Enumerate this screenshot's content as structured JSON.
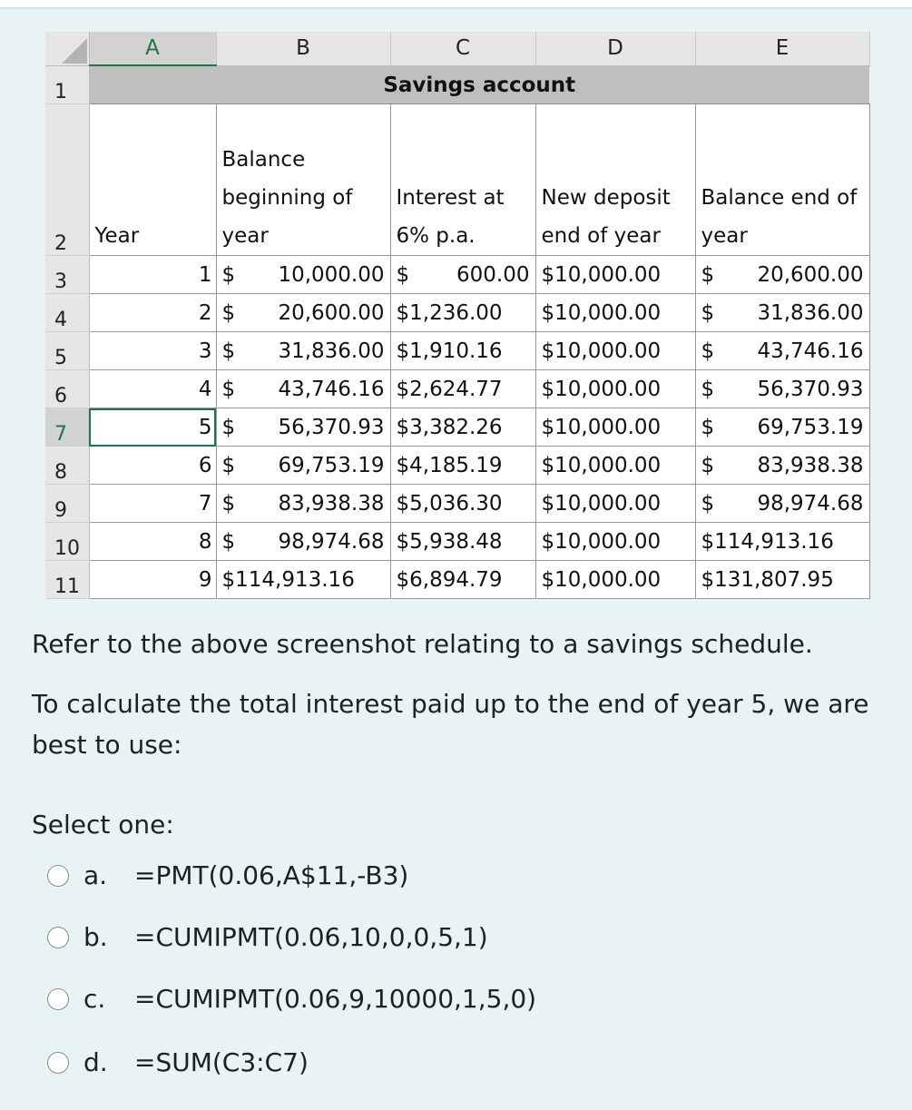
{
  "spreadsheet": {
    "columns": [
      "A",
      "B",
      "C",
      "D",
      "E"
    ],
    "selected_column": "A",
    "selected_row": "7",
    "title_row": {
      "row": "1",
      "title": "Savings account"
    },
    "header_row": {
      "row": "2",
      "year": "Year",
      "balance_begin": "Balance beginning of year",
      "interest": "Interest at 6% p.a.",
      "new_deposit": "New deposit end of year",
      "balance_end": "Balance end of year"
    },
    "rows": [
      {
        "row": "3",
        "year": "1",
        "balance_begin": "10,000.00",
        "interest": "600.00",
        "deposit": "$10,000.00",
        "balance_end": "20,600.00"
      },
      {
        "row": "4",
        "year": "2",
        "balance_begin": "20,600.00",
        "interest": "$1,236.00",
        "deposit": "$10,000.00",
        "balance_end": "31,836.00"
      },
      {
        "row": "5",
        "year": "3",
        "balance_begin": "31,836.00",
        "interest": "$1,910.16",
        "deposit": "$10,000.00",
        "balance_end": "43,746.16"
      },
      {
        "row": "6",
        "year": "4",
        "balance_begin": "43,746.16",
        "interest": "$2,624.77",
        "deposit": "$10,000.00",
        "balance_end": "56,370.93"
      },
      {
        "row": "7",
        "year": "5",
        "balance_begin": "56,370.93",
        "interest": "$3,382.26",
        "deposit": "$10,000.00",
        "balance_end": "69,753.19"
      },
      {
        "row": "8",
        "year": "6",
        "balance_begin": "69,753.19",
        "interest": "$4,185.19",
        "deposit": "$10,000.00",
        "balance_end": "83,938.38"
      },
      {
        "row": "9",
        "year": "7",
        "balance_begin": "83,938.38",
        "interest": "$5,036.30",
        "deposit": "$10,000.00",
        "balance_end": "98,974.68"
      },
      {
        "row": "10",
        "year": "8",
        "balance_begin": "98,974.68",
        "interest": "$5,938.48",
        "deposit": "$10,000.00",
        "balance_end": "$114,913.16"
      },
      {
        "row": "11",
        "year": "9",
        "balance_begin": "$114,913.16",
        "interest": "$6,894.79",
        "deposit": "$10,000.00",
        "balance_end": "$131,807.95"
      }
    ],
    "currency_symbol": "$"
  },
  "question": {
    "line1": "Refer to the above screenshot relating to a savings schedule.",
    "line2": "To calculate the total interest paid up to the end of year 5, we are best to use:",
    "select_label": "Select one:",
    "options": [
      {
        "letter": "a.",
        "text": "=PMT(0.06,A$11,-B3)"
      },
      {
        "letter": "b.",
        "text": "=CUMIPMT(0.06,10,0,0,5,1)"
      },
      {
        "letter": "c.",
        "text": "=CUMIPMT(0.06,9,10000,1,5,0)"
      },
      {
        "letter": "d.",
        "text": "=SUM(C3:C7)"
      }
    ]
  }
}
